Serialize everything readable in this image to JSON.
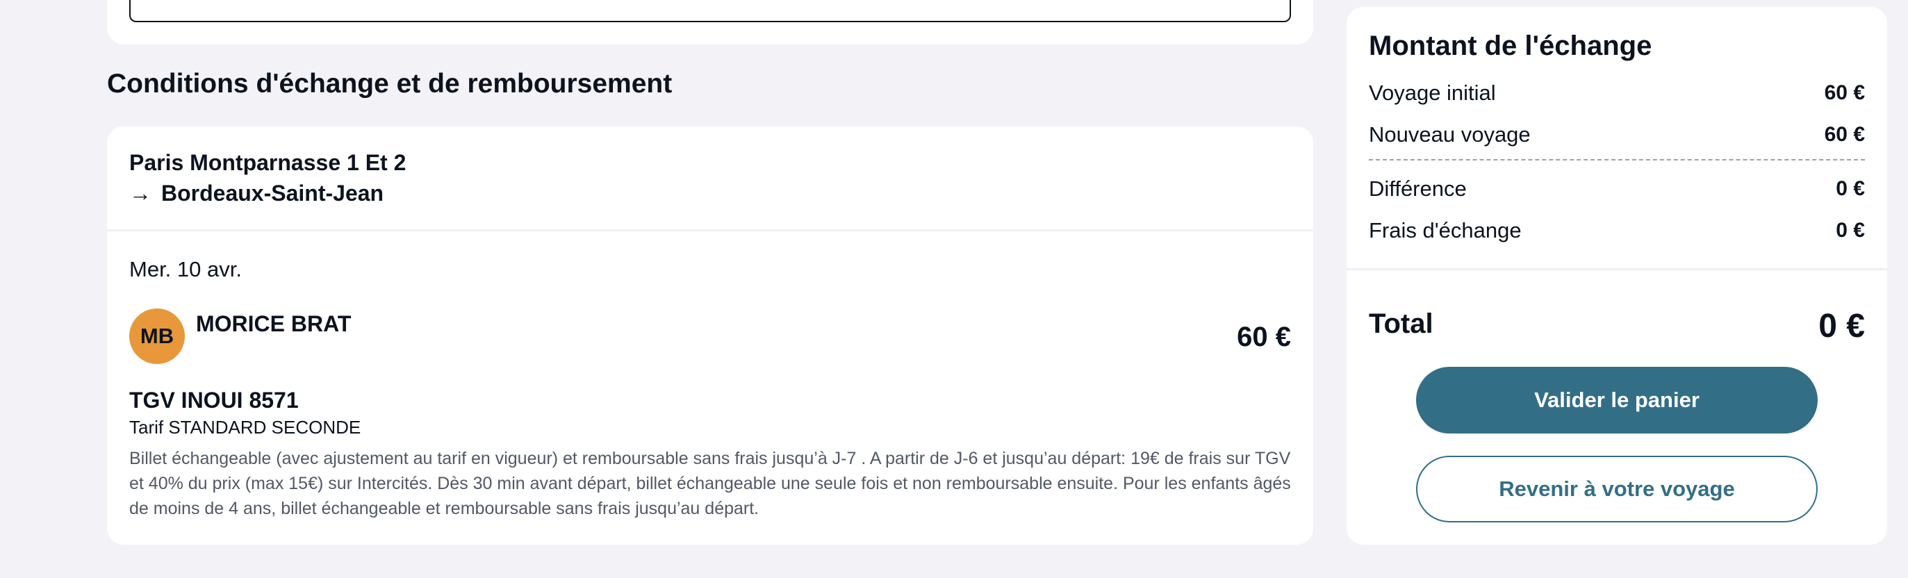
{
  "conditions_section": {
    "title": "Conditions d'échange et de remboursement",
    "route_from": "Paris Montparnasse 1 Et 2",
    "route_to": "Bordeaux-Saint-Jean",
    "route_arrow": "→",
    "date": "Mer. 10 avr.",
    "passenger": {
      "initials": "MB",
      "name": "MORICE BRAT",
      "price": "60 €",
      "avatar_color": "#e8983a"
    },
    "train": "TGV INOUI 8571",
    "tarif": "Tarif STANDARD SECONDE",
    "conditions_text": "Billet échangeable (avec ajustement au tarif en vigueur) et remboursable sans frais jusqu’à J-7 . A partir de J-6 et jusqu’au départ: 19€ de frais sur TGV et 40% du prix (max 15€) sur Intercités. Dès 30 min avant départ, billet échangeable une seule fois et non remboursable ensuite. Pour les enfants âgés de moins de 4 ans, billet échangeable et remboursable sans frais jusqu’au départ."
  },
  "summary": {
    "title": "Montant de l'échange",
    "rows": [
      {
        "label": "Voyage initial",
        "value": "60 €"
      },
      {
        "label": "Nouveau voyage",
        "value": "60 €"
      },
      {
        "label": "Différence",
        "value": "0 €"
      },
      {
        "label": "Frais d'échange",
        "value": "0 €"
      }
    ],
    "total_label": "Total",
    "total_value": "0 €",
    "primary_button": "Valider le panier",
    "secondary_button": "Revenir à votre voyage"
  },
  "colors": {
    "background": "#f3f3f7",
    "accent": "#336e87",
    "text": "#0c131f"
  }
}
